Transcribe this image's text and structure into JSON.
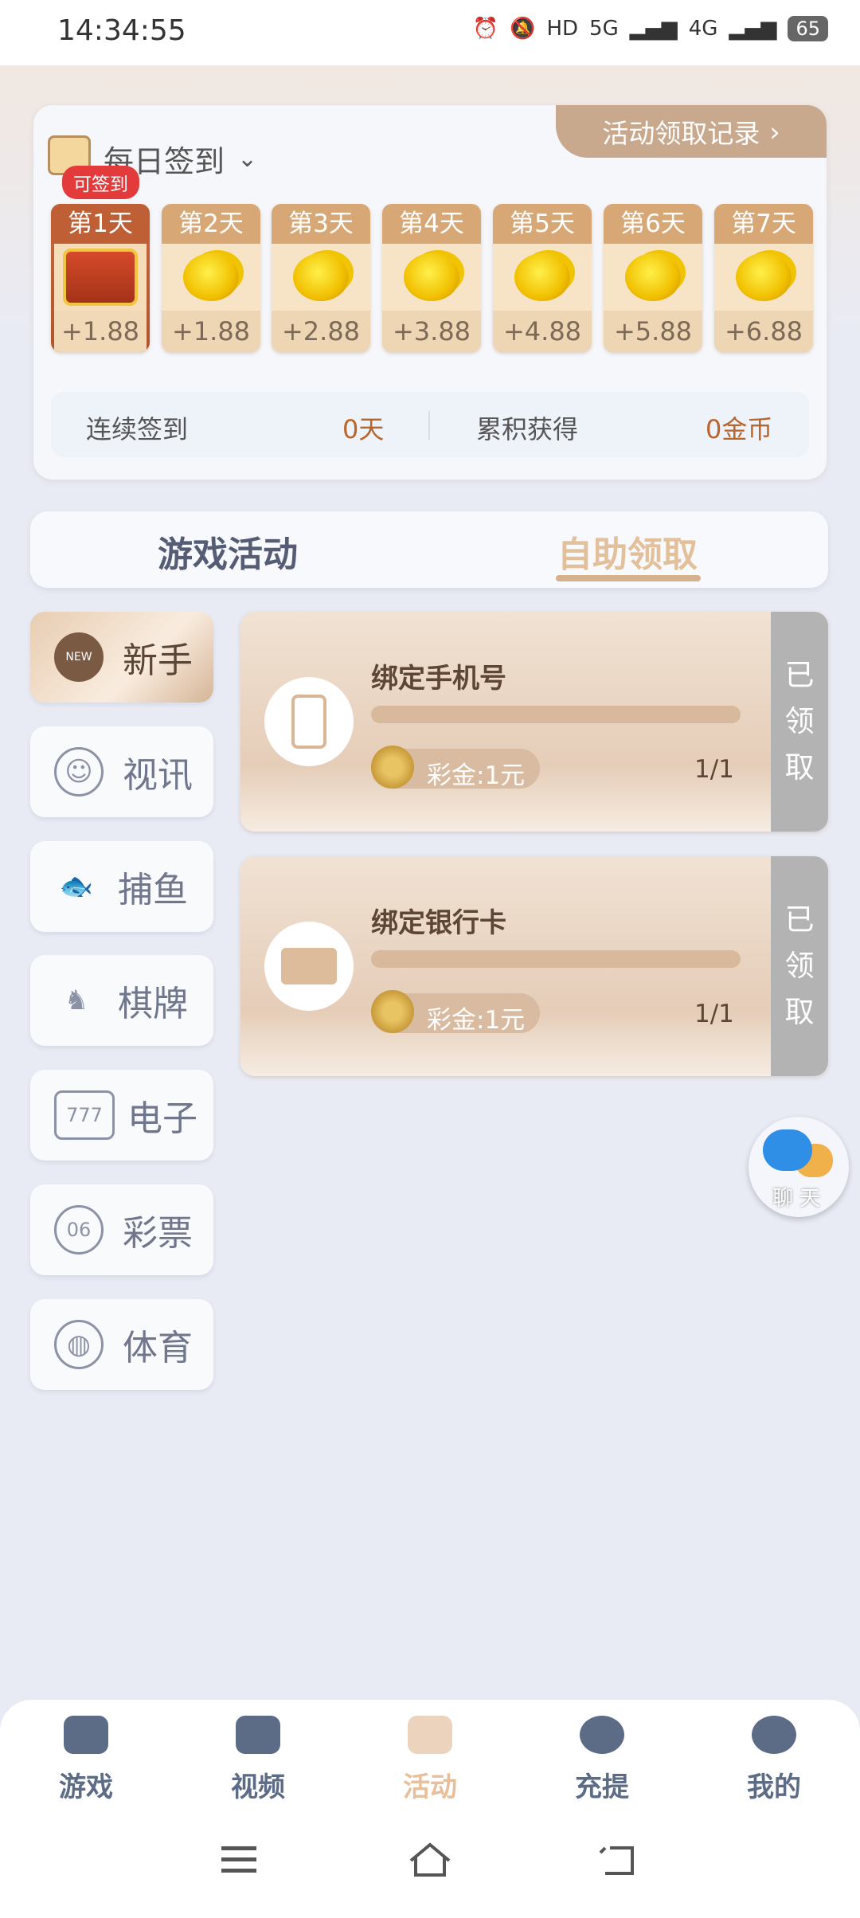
{
  "status_bar": {
    "time": "14:34:55",
    "network_1": "5G",
    "network_2": "4G",
    "battery": "65"
  },
  "signin": {
    "title": "每日签到",
    "record_label": "活动领取记录",
    "can_sign_badge": "可签到",
    "days": [
      {
        "label": "第1天",
        "amount": "+1.88",
        "reward_icon": "treasure-chest"
      },
      {
        "label": "第2天",
        "amount": "+1.88",
        "reward_icon": "gold-coins"
      },
      {
        "label": "第3天",
        "amount": "+2.88",
        "reward_icon": "gold-coins"
      },
      {
        "label": "第4天",
        "amount": "+3.88",
        "reward_icon": "gold-coins"
      },
      {
        "label": "第5天",
        "amount": "+4.88",
        "reward_icon": "gold-coins"
      },
      {
        "label": "第6天",
        "amount": "+5.88",
        "reward_icon": "gold-coins"
      },
      {
        "label": "第7天",
        "amount": "+6.88",
        "reward_icon": "gold-coins"
      }
    ],
    "streak_label": "连续签到",
    "streak_value": "0天",
    "total_label": "累积获得",
    "total_value": "0金币"
  },
  "tabs": {
    "game_activity": "游戏活动",
    "self_claim": "自助领取",
    "active": "self_claim"
  },
  "categories": [
    {
      "label": "新手",
      "icon": "new-user-icon",
      "badge": "NEW"
    },
    {
      "label": "视讯",
      "icon": "live-dealer-icon"
    },
    {
      "label": "捕鱼",
      "icon": "fish-icon"
    },
    {
      "label": "棋牌",
      "icon": "chess-knight-icon"
    },
    {
      "label": "电子",
      "icon": "slot-777-icon",
      "glyph": "777"
    },
    {
      "label": "彩票",
      "icon": "lottery-ball-icon",
      "glyph": "06"
    },
    {
      "label": "体育",
      "icon": "basketball-icon"
    }
  ],
  "tasks": [
    {
      "title": "绑定手机号",
      "bonus": "彩金:1元",
      "progress": "1/1",
      "progress_fraction": 1.0,
      "status_chars": [
        "已",
        "领",
        "取"
      ],
      "icon": "phone-icon"
    },
    {
      "title": "绑定银行卡",
      "bonus": "彩金:1元",
      "progress": "1/1",
      "progress_fraction": 1.0,
      "status_chars": [
        "已",
        "领",
        "取"
      ],
      "icon": "bank-card-icon"
    }
  ],
  "chat": {
    "label": "聊 天"
  },
  "bottom_nav": [
    {
      "label": "游戏",
      "icon": "gamepad-icon"
    },
    {
      "label": "视频",
      "icon": "video-icon"
    },
    {
      "label": "活动",
      "icon": "gift-icon",
      "active": true
    },
    {
      "label": "充提",
      "icon": "yen-icon"
    },
    {
      "label": "我的",
      "icon": "profile-icon"
    }
  ],
  "colors": {
    "accent": "#d6b18f",
    "active_day": "#b1532b",
    "claimed": "#b3b3b3",
    "highlight_text": "#b8642a"
  }
}
